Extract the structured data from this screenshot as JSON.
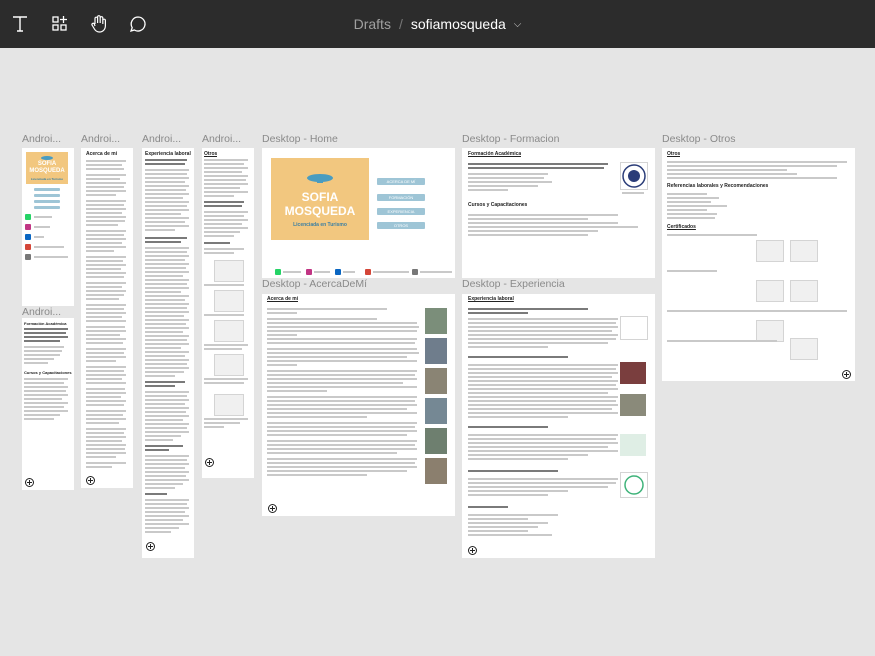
{
  "toolbar": {
    "tools": [
      "text-tool-icon",
      "frame-tool-icon",
      "hand-tool-icon",
      "comment-tool-icon"
    ],
    "breadcrumb": {
      "project": "Drafts",
      "separator": "/",
      "file": "sofiamosqueda"
    }
  },
  "frames": [
    {
      "label": "Androi...",
      "content": {
        "logo_line1": "SOFIA",
        "logo_line2": "MOSQUEDA",
        "logo_line3": "Licenciada en Turismo"
      }
    },
    {
      "label": "Androi...",
      "content": {
        "heading": "Acerca de mí"
      }
    },
    {
      "label": "Androi...",
      "content": {
        "heading": "Experiencia laboral"
      }
    },
    {
      "label": "Androi...",
      "content": {
        "heading": "Otros"
      }
    },
    {
      "label": "Desktop - Home",
      "content": {
        "logo_line1": "SOFIA",
        "logo_line2": "MOSQUEDA",
        "logo_line3": "Licenciada en Turismo",
        "nav": [
          "ACERCA DE MÍ",
          "FORMACIÓN",
          "EXPERIENCIA",
          "OTROS"
        ]
      }
    },
    {
      "label": "Desktop - Formacion",
      "content": {
        "heading": "Formación Académica",
        "subheading": "Cursos y Capacitaciones"
      }
    },
    {
      "label": "Desktop - Otros",
      "content": {
        "heading": "Otros",
        "subheading": "Referencias laborales y Recomendaciones",
        "subheading2": "Certificados"
      }
    },
    {
      "label": "Desktop - AcercaDeMí",
      "content": {
        "heading": "Acerca de mí"
      }
    },
    {
      "label": "Desktop - Experiencia",
      "content": {
        "heading": "Experiencia laboral"
      }
    },
    {
      "label": "Androi...",
      "content": {
        "heading": "Formación Académica",
        "subheading": "Cursos y Capacitaciones"
      }
    }
  ],
  "colors": {
    "toolbar": "#2c2c2c",
    "canvas": "#e5e5e5",
    "logo_bg": "#f2c77f",
    "nav_pill": "#9ec5d6"
  }
}
